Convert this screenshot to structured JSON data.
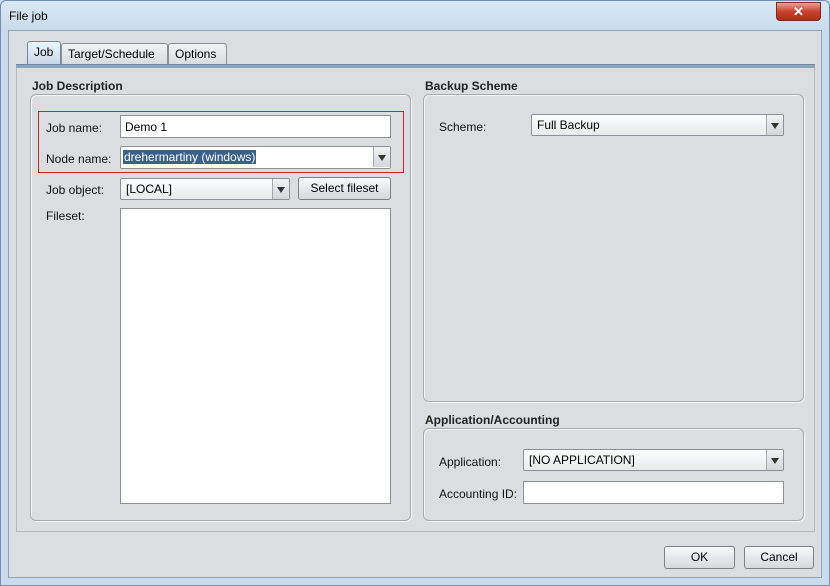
{
  "window": {
    "title": "File job",
    "close_glyph": "✕"
  },
  "tabs": [
    {
      "label": "Job",
      "active": true
    },
    {
      "label": "Target/Schedule",
      "active": false
    },
    {
      "label": "Options",
      "active": false
    }
  ],
  "job_description": {
    "heading": "Job Description",
    "job_name_label": "Job name:",
    "job_name_value": "Demo 1",
    "node_name_label": "Node name:",
    "node_name_value": "drehermartiny (windows)",
    "job_object_label": "Job object:",
    "job_object_value": "[LOCAL]",
    "select_fileset_label": "Select fileset",
    "fileset_label": "Fileset:"
  },
  "backup_scheme": {
    "heading": "Backup Scheme",
    "scheme_label": "Scheme:",
    "scheme_value": "Full Backup"
  },
  "application_accounting": {
    "heading": "Application/Accounting",
    "application_label": "Application:",
    "application_value": "[NO APPLICATION]",
    "accounting_id_label": "Accounting ID:",
    "accounting_id_value": ""
  },
  "footer": {
    "ok_label": "OK",
    "cancel_label": "Cancel"
  },
  "colors": {
    "highlight_border": "#c0282a",
    "selection": "#39618b",
    "tab_accent": "#8ba3bb"
  },
  "icons": {
    "close": "close-icon",
    "dropdown": "chevron-down-icon"
  }
}
